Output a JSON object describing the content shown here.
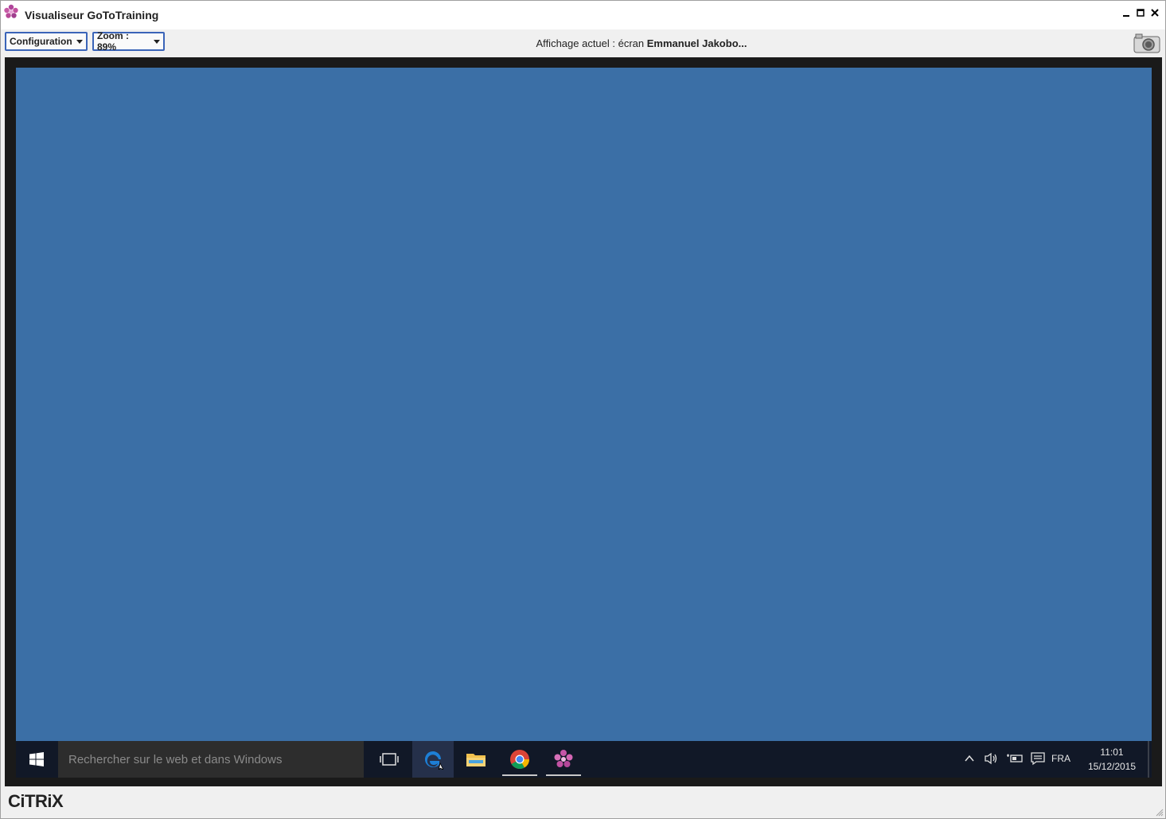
{
  "window": {
    "title": "Visualiseur GoToTraining",
    "controls": {
      "minimize": "▁",
      "maximize": "□",
      "close": "✕"
    }
  },
  "toolbar": {
    "configuration_label": "Configuration",
    "zoom_label": "Zoom : 89%",
    "status_prefix": "Affichage actuel : écran ",
    "status_name": "Emmanuel Jakobo..."
  },
  "remote_desktop": {
    "background_color": "#3b6fa6",
    "taskbar": {
      "search_placeholder": "Rechercher sur le web et dans Windows",
      "pinned": [
        {
          "name": "task-view-icon"
        },
        {
          "name": "edge-icon",
          "active": true
        },
        {
          "name": "file-explorer-icon"
        },
        {
          "name": "chrome-icon",
          "running": true
        },
        {
          "name": "gototraining-icon",
          "running": true
        }
      ],
      "tray": {
        "language": "FRA",
        "time": "11:01",
        "date": "15/12/2015"
      }
    }
  },
  "footer": {
    "brand": "CiTRiX"
  }
}
